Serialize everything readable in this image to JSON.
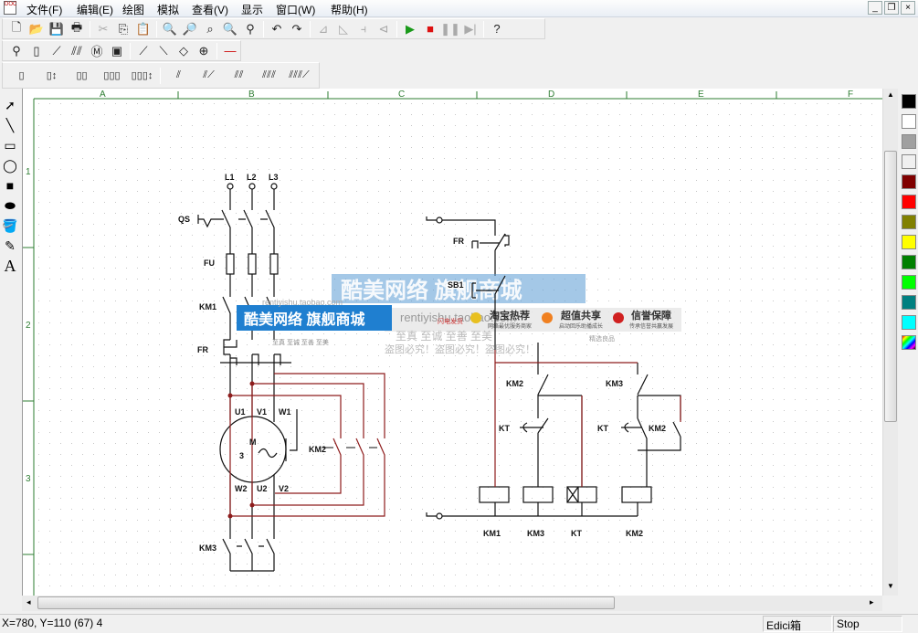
{
  "menu": {
    "items": [
      "文件(F)",
      "编辑(E)",
      "绘图",
      "模拟",
      "查看(V)",
      "显示",
      "窗口(W)",
      "帮助(H)"
    ],
    "app_icon": "doc-app-icon",
    "window_controls": [
      "_",
      "❐",
      "×"
    ]
  },
  "toolbar_main": [
    {
      "name": "new",
      "icon": "🗋"
    },
    {
      "name": "open",
      "icon": "📂"
    },
    {
      "name": "save",
      "icon": "💾"
    },
    {
      "name": "print",
      "icon": "🖶"
    },
    {
      "name": "cut",
      "icon": "✂",
      "disabled": true
    },
    {
      "name": "copy",
      "icon": "⎘"
    },
    {
      "name": "paste",
      "icon": "📋"
    },
    {
      "name": "zoom-in",
      "icon": "🔍"
    },
    {
      "name": "zoom-out",
      "icon": "🔎"
    },
    {
      "name": "zoom-area",
      "icon": "⌕"
    },
    {
      "name": "zoom-fit",
      "icon": "🔍"
    },
    {
      "name": "find",
      "icon": "⚲"
    },
    {
      "name": "undo",
      "icon": "↶"
    },
    {
      "name": "redo",
      "icon": "↷"
    },
    {
      "name": "rotate-left",
      "icon": "⊿",
      "disabled": true
    },
    {
      "name": "rotate-right",
      "icon": "◺",
      "disabled": true
    },
    {
      "name": "flip-h",
      "icon": "⫞",
      "disabled": true
    },
    {
      "name": "flip-v",
      "icon": "⊲",
      "disabled": true
    },
    {
      "name": "run",
      "icon": "▶",
      "color": "#1a9a1a"
    },
    {
      "name": "stop",
      "icon": "■",
      "color": "#dd1111"
    },
    {
      "name": "pause",
      "icon": "❚❚",
      "disabled": true
    },
    {
      "name": "step",
      "icon": "▶|",
      "disabled": true
    },
    {
      "name": "help",
      "icon": "?"
    }
  ],
  "toolbar_components": [
    "⚲",
    "▯",
    "⟋",
    "⫽⫽",
    "Ⓜ",
    "▣",
    "⟋",
    "⟍",
    "◇",
    "⊕",
    "—"
  ],
  "toolbar_contacts": [
    "▯",
    "▯↕",
    "▯▯",
    "▯▯▯",
    "▯▯▯↕",
    "⫽",
    "⫽⟋",
    "⫽⫽",
    "⫽⫽⫽",
    "⫽⫽⫽⟋"
  ],
  "toolbox": [
    {
      "name": "select",
      "icon": "➚"
    },
    {
      "name": "line",
      "icon": "╲"
    },
    {
      "name": "rectangle",
      "icon": "▭"
    },
    {
      "name": "ellipse",
      "icon": "◯"
    },
    {
      "name": "filled-rectangle",
      "icon": "■"
    },
    {
      "name": "filled-ellipse",
      "icon": "⬬"
    },
    {
      "name": "fill",
      "icon": "🪣"
    },
    {
      "name": "color-picker",
      "icon": "✎"
    },
    {
      "name": "text",
      "icon": "A"
    }
  ],
  "ruler": {
    "columns": [
      "A",
      "B",
      "C",
      "D",
      "E",
      "F"
    ],
    "rows": [
      "1",
      "2",
      "3"
    ]
  },
  "palette": [
    "#000000",
    "#ffffff",
    "#a0a0a0",
    "#f0f0f0",
    "#800000",
    "#ff0000",
    "#808000",
    "#ffff00",
    "#008000",
    "#00ff00",
    "#008080",
    "#00ffff"
  ],
  "colors": {
    "wire_red": "#8e1c1c",
    "wire_black": "#111111",
    "grid": "#cccccc",
    "frame": "#2e7d32"
  },
  "diagram": {
    "power": {
      "phases": [
        "L1",
        "L2",
        "L3"
      ],
      "qs": "QS",
      "fu": "FU",
      "km1": "KM1",
      "fr": "FR",
      "motor": {
        "m": "M",
        "phases": "3",
        "sym": "~",
        "top": [
          "U1",
          "V1",
          "W1"
        ],
        "bottom": [
          "W2",
          "U2",
          "V2"
        ]
      },
      "km2": "KM2",
      "km3": "KM3"
    },
    "control": {
      "fr": "FR",
      "sb1": "SB1",
      "km2_nc": "KM2",
      "kt_nc": "KT",
      "km3_nc": "KM3",
      "kt_no": "KT",
      "km2_no": "KM2",
      "coils": [
        "KM1",
        "KM3",
        "KT",
        "KM2"
      ]
    }
  },
  "watermark": {
    "title": "酷美网络 旗舰商城",
    "url": "rentiyishu.taobao.com",
    "badges": [
      "淘宝热荐",
      "超值共享",
      "信誉保障"
    ],
    "sub": [
      "网络最优服务商家",
      "启动回乐助播成长",
      "传承信誉共赢发展"
    ],
    "motto": "至真 至诚  至善 至美",
    "warning": "盗图必究！盗图必究！盗图必究！",
    "extra": [
      "闪电发货",
      "精选良品"
    ]
  },
  "status": {
    "coords": "X=780, Y=110 (67) 4",
    "mode": "Edici箱",
    "sim": "Stop"
  }
}
